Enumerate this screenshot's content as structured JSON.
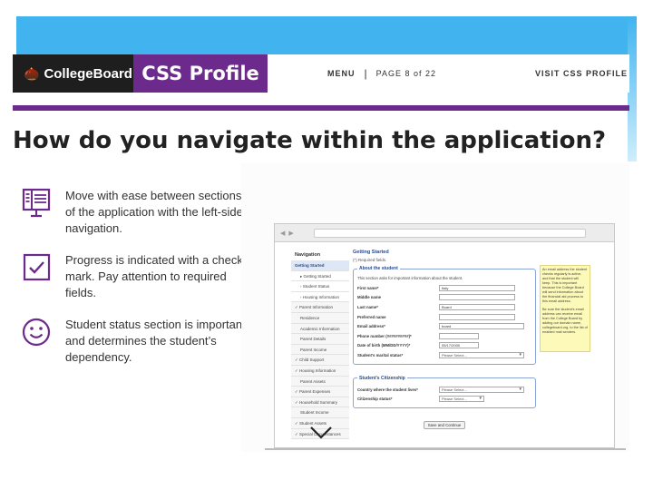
{
  "header": {
    "collegeboard_logo_text": "CollegeBoard",
    "css_profile_logo_text": "CSS Profile",
    "menu_label": "MENU",
    "separator": "|",
    "pager": "PAGE 8 of 22",
    "visit_label": "VISIT CSS PROFILE"
  },
  "colors": {
    "brand_purple": "#6c2a8c",
    "accent_blue": "#41b4f0",
    "logo_black": "#1e1e1e"
  },
  "title": "How do you navigate within the application?",
  "features": [
    {
      "icon": "navigation-panel-icon",
      "text": "Move with ease between sections of the application with the left-side navigation."
    },
    {
      "icon": "checkbox-icon",
      "text": "Progress is indicated with a check mark. Pay attention to required fields."
    },
    {
      "icon": "smiley-face-icon",
      "text": "Student status section is important and determines the student’s dependency."
    }
  ],
  "screenshot": {
    "nav_heading": "Navigation",
    "nav_items": [
      "Getting Started",
      "▸ Getting Started",
      "› Student Status",
      "› Housing Information",
      "✓ Parent Information",
      "Residence",
      "Academic Information",
      "Parent Details",
      "Parent Income",
      "✓ Child Support",
      "✓ Housing Information",
      "Parent Assets",
      "✓ Parent Expenses",
      "✓ Household Summary",
      "Student Income",
      "✓ Student Assets",
      "✓ Special Circumstances"
    ],
    "page_heading": "Getting Started",
    "required_note": "(*) Required fields.",
    "about": {
      "legend": "About the student",
      "note": "This section asks for important information about the student.",
      "fields": [
        {
          "label": "First name*",
          "value": "Italy"
        },
        {
          "label": "Middle name",
          "value": ""
        },
        {
          "label": "Last name*",
          "value": "Board"
        },
        {
          "label": "Preferred name",
          "value": ""
        },
        {
          "label": "Email address*",
          "value": "board"
        },
        {
          "label": "Phone number (##########)*",
          "value": ""
        },
        {
          "label": "Date of birth (MM/DD/YYYY)*",
          "value": "05/17/2000"
        }
      ],
      "marital_label": "Student's marital status*",
      "marital_value": "Please Select..."
    },
    "citizenship": {
      "legend": "Student's Citizenship",
      "country_label": "Country where the student lives*",
      "country_value": "Please Select...",
      "status_label": "Citizenship status*",
      "status_value": "Please Select..."
    },
    "save_button": "Save and Continue",
    "tip_p1": "An email address the student checks regularly is active, and that the student will keep. This is important because the College Board will send information about the financial aid process to this email address.",
    "tip_p2": "Be sure the student's email address can receive email from the College Board by adding our domain name, collegeboard.org, to the list of enabled mail senders."
  }
}
